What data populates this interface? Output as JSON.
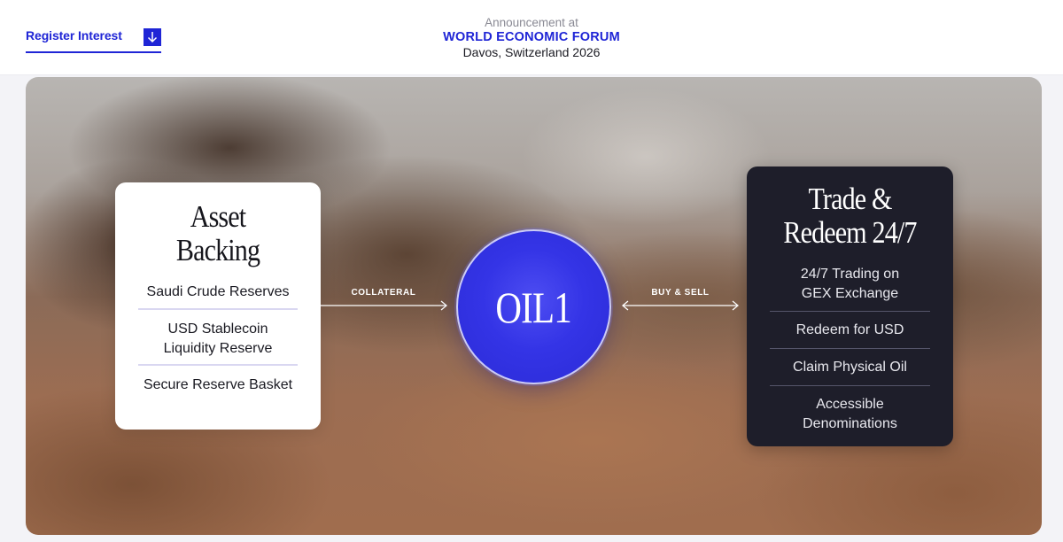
{
  "header": {
    "register_label": "Register Interest",
    "announcement_pre": "Announcement at",
    "announcement_event": "WORLD ECONOMIC FORUM",
    "announcement_place": "Davos, Switzerland 2026",
    "accent_color": "#1f25d6"
  },
  "asset_card": {
    "title_line1": "Asset",
    "title_line2": "Backing",
    "items": [
      "Saudi Crude Reserves",
      "USD Stablecoin",
      "Liquidity Reserve",
      "Secure Reserve Basket"
    ]
  },
  "token": {
    "label": "OIL1",
    "color": "#3434e6"
  },
  "connectors": {
    "left_label": "COLLATERAL",
    "right_label": "BUY & SELL"
  },
  "trade_card": {
    "title_line1": "Trade &",
    "title_line2": "Redeem 24/7",
    "items": [
      "24/7 Trading on",
      "GEX Exchange",
      "Redeem for USD",
      "Claim Physical Oil",
      "Accessible",
      "Denominations"
    ]
  }
}
